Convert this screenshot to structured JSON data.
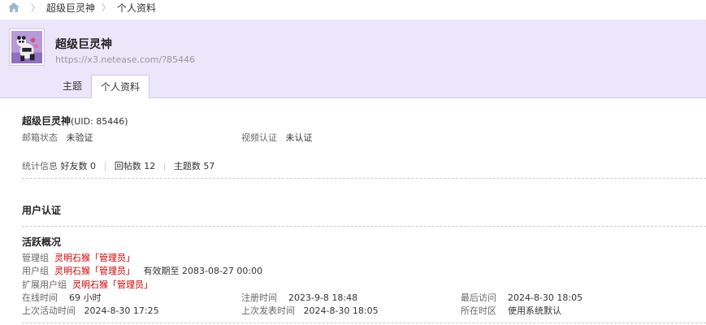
{
  "breadcrumb": {
    "items": [
      "超级巨灵神",
      "个人资料"
    ]
  },
  "profile": {
    "name": "超级巨灵神",
    "url": "https://x3.netease.com/?85446"
  },
  "tabs": [
    "主题",
    "个人资料"
  ],
  "info": {
    "name": "超级巨灵神",
    "uid": "(UID: 85446)",
    "email_label": "邮箱状态",
    "email_value": "未验证",
    "video_label": "视频认证",
    "video_value": "未认证",
    "stats_label": "统计信息",
    "friends": "好友数 0",
    "replies": "回帖数 12",
    "threads": "主题数 57"
  },
  "auth": {
    "title": "用户认证"
  },
  "activity": {
    "title": "活跃概况",
    "admin_group_label": "管理组",
    "admin_group_value": "灵明石猴「管理员」",
    "user_group_label": "用户组",
    "user_group_value": "灵明石猴「管理员」",
    "user_group_expiry": "有效期至 2083-08-27 00:00",
    "ext_group_label": "扩展用户组",
    "ext_group_value": "灵明石猴「管理员」",
    "online_label": "在线时间",
    "online_value": "69 小时",
    "reg_label": "注册时间",
    "reg_value": "2023-9-8 18:48",
    "last_visit_label": "最后访问",
    "last_visit_value": "2024-8-30 18:05",
    "last_active_label": "上次活动时间",
    "last_active_value": "2024-8-30 17:25",
    "last_post_label": "上次发表时间",
    "last_post_value": "2024-8-30 18:05",
    "timezone_label": "所在时区",
    "timezone_value": "使用系统默认"
  },
  "colors": {
    "header_bg": "#ebe6fa",
    "group_red": "#cc0000"
  }
}
